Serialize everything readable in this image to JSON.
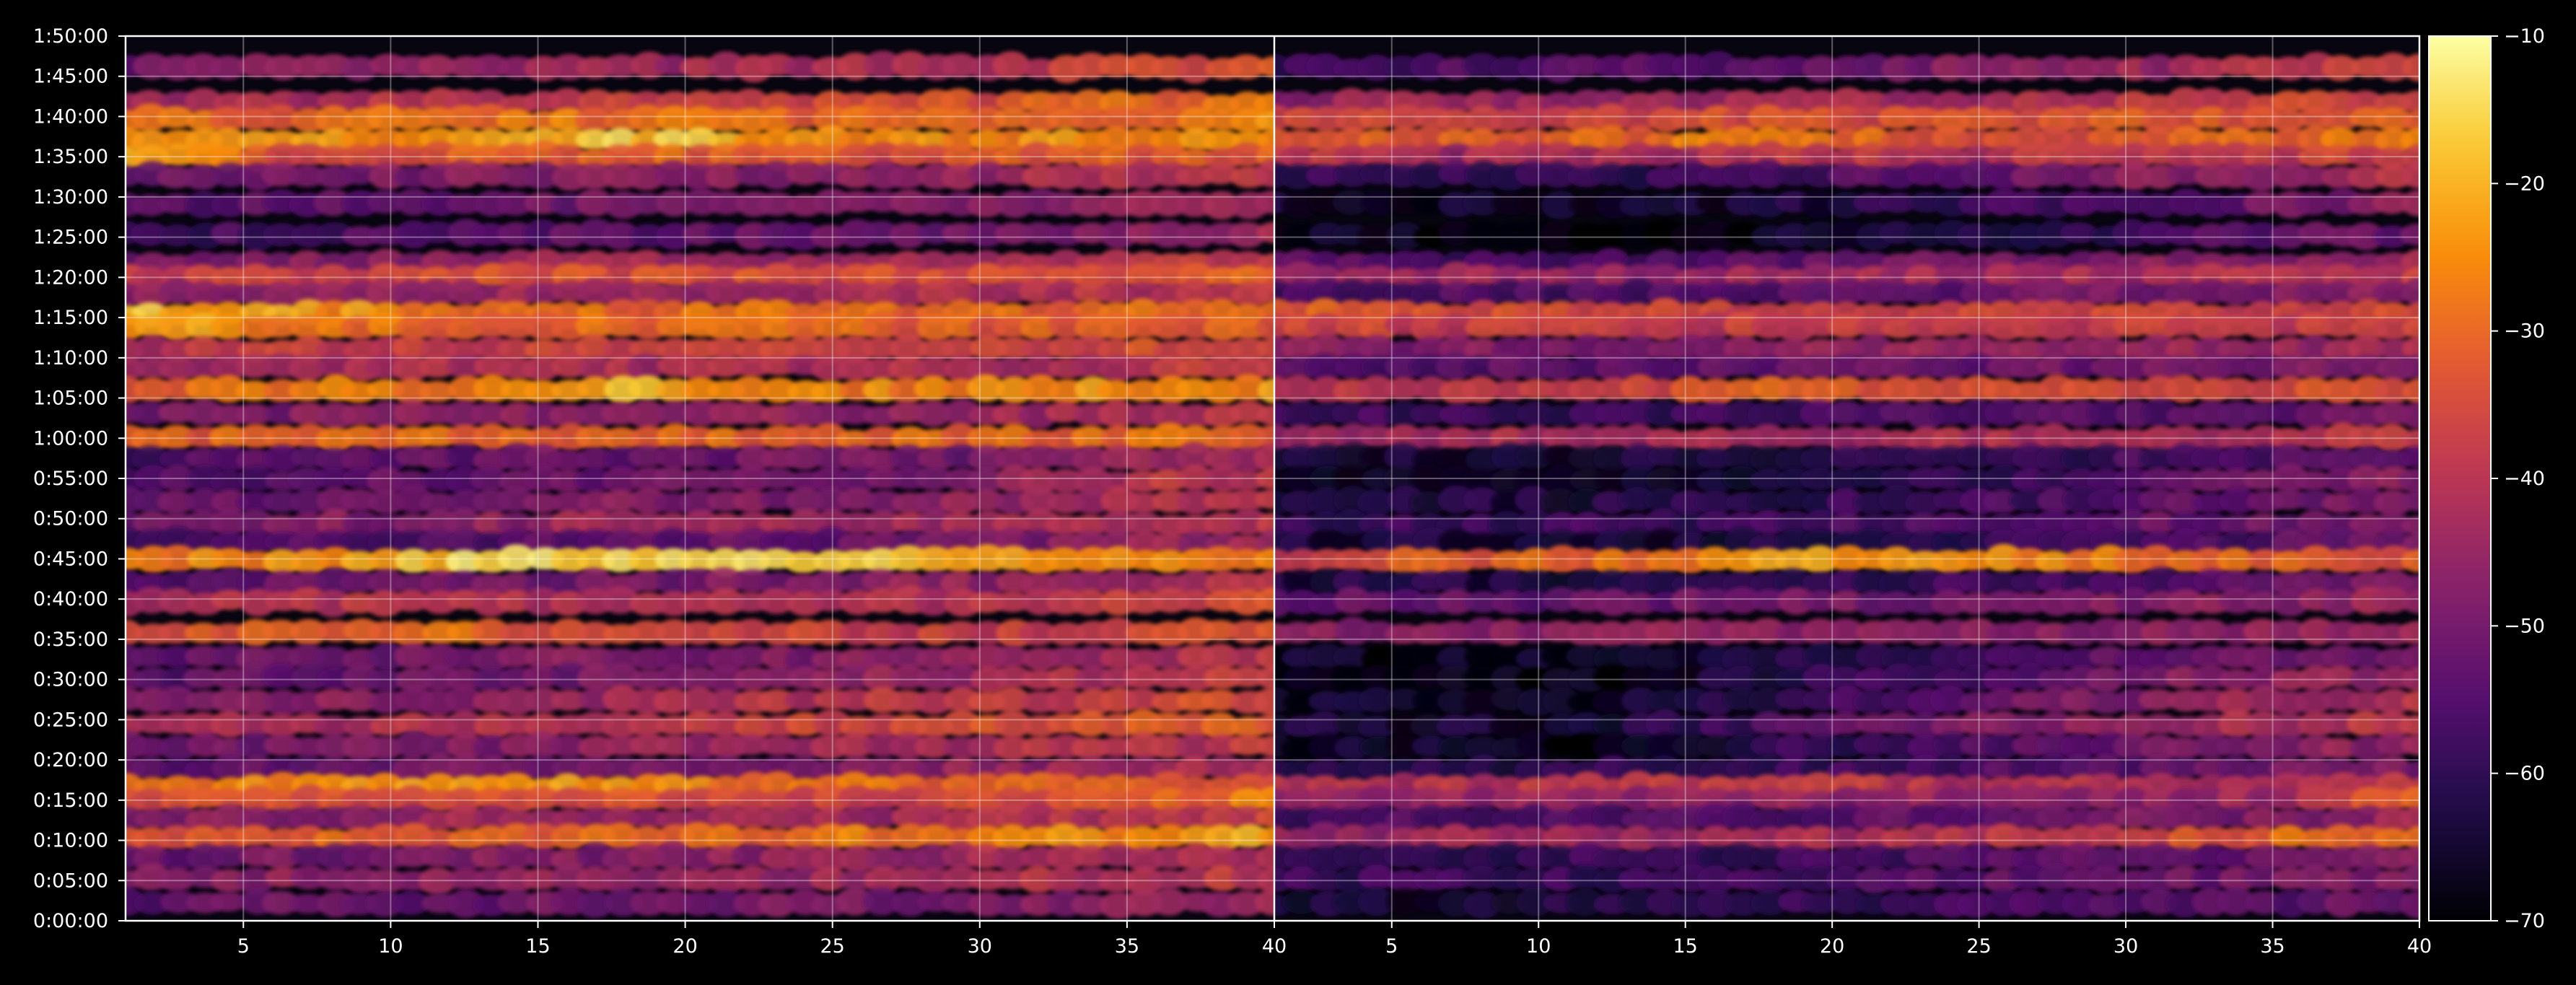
{
  "chart_data": {
    "type": "heatmap",
    "title": "",
    "xlabel": "",
    "ylabel": "",
    "panels": [
      {
        "name": "",
        "x_range": [
          1,
          40
        ]
      },
      {
        "name": "",
        "x_range": [
          1,
          40
        ]
      }
    ],
    "x_ticks": [
      {
        "value": 5,
        "label": "5",
        "panel": 0
      },
      {
        "value": 10,
        "label": "10",
        "panel": 0
      },
      {
        "value": 15,
        "label": "15",
        "panel": 0
      },
      {
        "value": 20,
        "label": "20",
        "panel": 0
      },
      {
        "value": 25,
        "label": "25",
        "panel": 0
      },
      {
        "value": 30,
        "label": "30",
        "panel": 0
      },
      {
        "value": 35,
        "label": "35",
        "panel": 0
      },
      {
        "value": 40,
        "label": "40",
        "panel": 0
      },
      {
        "value": 5,
        "label": "5",
        "panel": 1
      },
      {
        "value": 10,
        "label": "10",
        "panel": 1
      },
      {
        "value": 15,
        "label": "15",
        "panel": 1
      },
      {
        "value": 20,
        "label": "20",
        "panel": 1
      },
      {
        "value": 25,
        "label": "25",
        "panel": 1
      },
      {
        "value": 30,
        "label": "30",
        "panel": 1
      },
      {
        "value": 35,
        "label": "35",
        "panel": 1
      },
      {
        "value": 40,
        "label": "40",
        "panel": 1
      }
    ],
    "y_range_seconds": [
      0,
      6600
    ],
    "y_ticks": [
      {
        "value": 0,
        "label": "0:00:00"
      },
      {
        "value": 300,
        "label": "0:05:00"
      },
      {
        "value": 600,
        "label": "0:10:00"
      },
      {
        "value": 900,
        "label": "0:15:00"
      },
      {
        "value": 1200,
        "label": "0:20:00"
      },
      {
        "value": 1500,
        "label": "0:25:00"
      },
      {
        "value": 1800,
        "label": "0:30:00"
      },
      {
        "value": 2100,
        "label": "0:35:00"
      },
      {
        "value": 2400,
        "label": "0:40:00"
      },
      {
        "value": 2700,
        "label": "0:45:00"
      },
      {
        "value": 3000,
        "label": "0:50:00"
      },
      {
        "value": 3300,
        "label": "0:55:00"
      },
      {
        "value": 3600,
        "label": "1:00:00"
      },
      {
        "value": 3900,
        "label": "1:05:00"
      },
      {
        "value": 4200,
        "label": "1:10:00"
      },
      {
        "value": 4500,
        "label": "1:15:00"
      },
      {
        "value": 4800,
        "label": "1:20:00"
      },
      {
        "value": 5100,
        "label": "1:25:00"
      },
      {
        "value": 5400,
        "label": "1:30:00"
      },
      {
        "value": 5700,
        "label": "1:35:00"
      },
      {
        "value": 6000,
        "label": "1:40:00"
      },
      {
        "value": 6300,
        "label": "1:45:00"
      },
      {
        "value": 6600,
        "label": "1:50:00"
      }
    ],
    "colorbar": {
      "colormap": "inferno",
      "range": [
        -70,
        -10
      ],
      "ticks": [
        {
          "value": -10,
          "label": "−10"
        },
        {
          "value": -20,
          "label": "−20"
        },
        {
          "value": -30,
          "label": "−30"
        },
        {
          "value": -40,
          "label": "−40"
        },
        {
          "value": -50,
          "label": "−50"
        },
        {
          "value": -60,
          "label": "−60"
        },
        {
          "value": -70,
          "label": "−70"
        }
      ]
    },
    "grid": true,
    "bands_note_units": "time in seconds, level in colorbar units",
    "bands": [
      {
        "t": 6370,
        "left": [
          -50,
          -48,
          -46,
          -44,
          -42,
          -40,
          -36,
          -32
        ],
        "right": [
          -58,
          -56,
          -54,
          -52,
          -48,
          -45,
          -40,
          -38
        ]
      },
      {
        "t": 6100,
        "left": [
          -44,
          -42,
          -40,
          -38,
          -36,
          -34,
          -30,
          -28
        ],
        "right": [
          -46,
          -44,
          -44,
          -42,
          -42,
          -40,
          -36,
          -34
        ]
      },
      {
        "t": 5980,
        "left": [
          -30,
          -30,
          -28,
          -28,
          -30,
          -30,
          -28,
          -26
        ],
        "right": [
          -36,
          -36,
          -35,
          -34,
          -34,
          -33,
          -32,
          -30
        ]
      },
      {
        "t": 5820,
        "left": [
          -26,
          -24,
          -22,
          -16,
          -24,
          -25,
          -24,
          -24
        ],
        "right": [
          -32,
          -33,
          -30,
          -26,
          -32,
          -33,
          -30,
          -26
        ]
      },
      {
        "t": 5700,
        "left": [
          -20,
          -34,
          -32,
          -30,
          -34,
          -33,
          -32,
          -30
        ],
        "right": [
          -36,
          -44,
          -42,
          -40,
          -40,
          -38,
          -38,
          -36
        ]
      },
      {
        "t": 5560,
        "left": [
          -52,
          -50,
          -48,
          -46,
          -46,
          -44,
          -40,
          -36
        ],
        "right": [
          -58,
          -60,
          -60,
          -58,
          -52,
          -48,
          -44,
          -40
        ]
      },
      {
        "t": 5350,
        "left": [
          -56,
          -54,
          -52,
          -50,
          -50,
          -48,
          -46,
          -40
        ],
        "right": [
          -64,
          -66,
          -66,
          -64,
          -58,
          -56,
          -50,
          -46
        ]
      },
      {
        "t": 5120,
        "left": [
          -58,
          -56,
          -54,
          -54,
          -52,
          -50,
          -46,
          -42
        ],
        "right": [
          -66,
          -68,
          -68,
          -66,
          -62,
          -58,
          -54,
          -50
        ]
      },
      {
        "t": 4900,
        "left": [
          -50,
          -48,
          -46,
          -44,
          -44,
          -42,
          -40,
          -36
        ],
        "right": [
          -54,
          -56,
          -56,
          -54,
          -50,
          -48,
          -46,
          -44
        ]
      },
      {
        "t": 4800,
        "left": [
          -38,
          -36,
          -34,
          -34,
          -34,
          -34,
          -32,
          -30
        ],
        "right": [
          -44,
          -44,
          -44,
          -44,
          -42,
          -42,
          -40,
          -38
        ]
      },
      {
        "t": 4680,
        "left": [
          -48,
          -46,
          -44,
          -44,
          -44,
          -42,
          -40,
          -38
        ],
        "right": [
          -56,
          -56,
          -56,
          -54,
          -52,
          -50,
          -48,
          -46
        ]
      },
      {
        "t": 4530,
        "left": [
          -18,
          -22,
          -28,
          -30,
          -28,
          -30,
          -30,
          -30
        ],
        "right": [
          -30,
          -34,
          -36,
          -36,
          -36,
          -36,
          -36,
          -36
        ]
      },
      {
        "t": 4430,
        "left": [
          -22,
          -26,
          -30,
          -30,
          -30,
          -32,
          -32,
          -32
        ],
        "right": [
          -34,
          -38,
          -38,
          -38,
          -38,
          -38,
          -38,
          -38
        ]
      },
      {
        "t": 4260,
        "left": [
          -40,
          -38,
          -38,
          -36,
          -36,
          -36,
          -34,
          -32
        ],
        "right": [
          -48,
          -48,
          -48,
          -46,
          -46,
          -46,
          -44,
          -42
        ]
      },
      {
        "t": 4130,
        "left": [
          -46,
          -44,
          -42,
          -42,
          -42,
          -42,
          -40,
          -36
        ],
        "right": [
          -54,
          -54,
          -54,
          -52,
          -52,
          -50,
          -48,
          -46
        ]
      },
      {
        "t": 3960,
        "left": [
          -32,
          -28,
          -26,
          -18,
          -26,
          -26,
          -24,
          -24
        ],
        "right": [
          -40,
          -38,
          -36,
          -30,
          -36,
          -36,
          -34,
          -32
        ]
      },
      {
        "t": 3780,
        "left": [
          -50,
          -48,
          -46,
          -46,
          -46,
          -44,
          -42,
          -38
        ],
        "right": [
          -58,
          -58,
          -58,
          -56,
          -56,
          -54,
          -52,
          -50
        ]
      },
      {
        "t": 3600,
        "left": [
          -32,
          -30,
          -30,
          -30,
          -30,
          -30,
          -30,
          -30
        ],
        "right": [
          -44,
          -42,
          -42,
          -42,
          -42,
          -42,
          -40,
          -40
        ]
      },
      {
        "t": 3450,
        "left": [
          -56,
          -54,
          -52,
          -52,
          -50,
          -50,
          -46,
          -40
        ],
        "right": [
          -64,
          -64,
          -64,
          -62,
          -60,
          -58,
          -54,
          -50
        ]
      },
      {
        "t": 3290,
        "left": [
          -56,
          -54,
          -52,
          -52,
          -50,
          -48,
          -40,
          -38
        ],
        "right": [
          -66,
          -66,
          -66,
          -64,
          -60,
          -56,
          -48,
          -46
        ]
      },
      {
        "t": 3130,
        "left": [
          -52,
          -50,
          -50,
          -48,
          -48,
          -46,
          -42,
          -38
        ],
        "right": [
          -62,
          -62,
          -62,
          -60,
          -58,
          -56,
          -52,
          -48
        ]
      },
      {
        "t": 2960,
        "left": [
          -50,
          -48,
          -46,
          -44,
          -44,
          -42,
          -40,
          -38
        ],
        "right": [
          -58,
          -58,
          -58,
          -56,
          -54,
          -52,
          -50,
          -46
        ]
      },
      {
        "t": 2820,
        "left": [
          -56,
          -54,
          -54,
          -52,
          -52,
          -50,
          -46,
          -42
        ],
        "right": [
          -64,
          -64,
          -64,
          -62,
          -60,
          -58,
          -54,
          -50
        ]
      },
      {
        "t": 2690,
        "left": [
          -28,
          -24,
          -16,
          -14,
          -16,
          -20,
          -26,
          -26
        ],
        "right": [
          -36,
          -32,
          -28,
          -24,
          -24,
          -26,
          -32,
          -32
        ]
      },
      {
        "t": 2520,
        "left": [
          -54,
          -52,
          -50,
          -50,
          -48,
          -46,
          -42,
          -38
        ],
        "right": [
          -62,
          -62,
          -62,
          -60,
          -58,
          -56,
          -52,
          -48
        ]
      },
      {
        "t": 2380,
        "left": [
          -42,
          -40,
          -40,
          -40,
          -40,
          -40,
          -38,
          -34
        ],
        "right": [
          -52,
          -52,
          -52,
          -50,
          -50,
          -48,
          -46,
          -44
        ]
      },
      {
        "t": 2150,
        "left": [
          -34,
          -30,
          -30,
          -34,
          -36,
          -38,
          -36,
          -34
        ],
        "right": [
          -46,
          -46,
          -46,
          -46,
          -46,
          -46,
          -44,
          -42
        ]
      },
      {
        "t": 1960,
        "left": [
          -52,
          -50,
          -50,
          -48,
          -48,
          -46,
          -42,
          -40
        ],
        "right": [
          -66,
          -66,
          -66,
          -62,
          -58,
          -54,
          -50,
          -48
        ]
      },
      {
        "t": 1810,
        "left": [
          -54,
          -52,
          -50,
          -50,
          -48,
          -44,
          -40,
          -38
        ],
        "right": [
          -68,
          -68,
          -68,
          -62,
          -56,
          -50,
          -46,
          -42
        ]
      },
      {
        "t": 1640,
        "left": [
          -50,
          -48,
          -46,
          -44,
          -40,
          -38,
          -36,
          -34
        ],
        "right": [
          -66,
          -66,
          -66,
          -60,
          -54,
          -48,
          -44,
          -40
        ]
      },
      {
        "t": 1460,
        "left": [
          -44,
          -42,
          -40,
          -38,
          -36,
          -34,
          -32,
          -30
        ],
        "right": [
          -64,
          -64,
          -64,
          -56,
          -50,
          -46,
          -42,
          -38
        ]
      },
      {
        "t": 1300,
        "left": [
          -52,
          -50,
          -48,
          -46,
          -44,
          -42,
          -40,
          -38
        ],
        "right": [
          -66,
          -66,
          -66,
          -60,
          -56,
          -52,
          -48,
          -44
        ]
      },
      {
        "t": 1130,
        "left": [
          -54,
          -52,
          -50,
          -50,
          -48,
          -46,
          -44,
          -42
        ],
        "right": [
          -62,
          -62,
          -60,
          -58,
          -56,
          -54,
          -50,
          -48
        ]
      },
      {
        "t": 1000,
        "left": [
          -28,
          -24,
          -22,
          -24,
          -28,
          -30,
          -32,
          -30
        ],
        "right": [
          -40,
          -40,
          -38,
          -38,
          -40,
          -40,
          -40,
          -38
        ]
      },
      {
        "t": 900,
        "left": [
          -36,
          -34,
          -34,
          -34,
          -36,
          -36,
          -34,
          -22
        ],
        "right": [
          -46,
          -46,
          -46,
          -46,
          -46,
          -46,
          -44,
          -24
        ]
      },
      {
        "t": 760,
        "left": [
          -48,
          -46,
          -44,
          -44,
          -44,
          -42,
          -40,
          -36
        ],
        "right": [
          -56,
          -56,
          -56,
          -54,
          -52,
          -50,
          -48,
          -44
        ]
      },
      {
        "t": 620,
        "left": [
          -32,
          -30,
          -30,
          -30,
          -28,
          -26,
          -24,
          -22
        ],
        "right": [
          -46,
          -44,
          -44,
          -42,
          -40,
          -36,
          -30,
          -26
        ]
      },
      {
        "t": 470,
        "left": [
          -52,
          -50,
          -48,
          -48,
          -46,
          -44,
          -42,
          -40
        ],
        "right": [
          -60,
          -60,
          -58,
          -58,
          -56,
          -54,
          -50,
          -48
        ]
      },
      {
        "t": 310,
        "left": [
          -48,
          -46,
          -46,
          -44,
          -44,
          -42,
          -40,
          -38
        ],
        "right": [
          -58,
          -58,
          -58,
          -56,
          -54,
          -52,
          -50,
          -48
        ]
      },
      {
        "t": 130,
        "left": [
          -54,
          -52,
          -52,
          -50,
          -50,
          -48,
          -46,
          -42
        ],
        "right": [
          -64,
          -64,
          -62,
          -60,
          -58,
          -56,
          -54,
          -50
        ]
      }
    ]
  }
}
